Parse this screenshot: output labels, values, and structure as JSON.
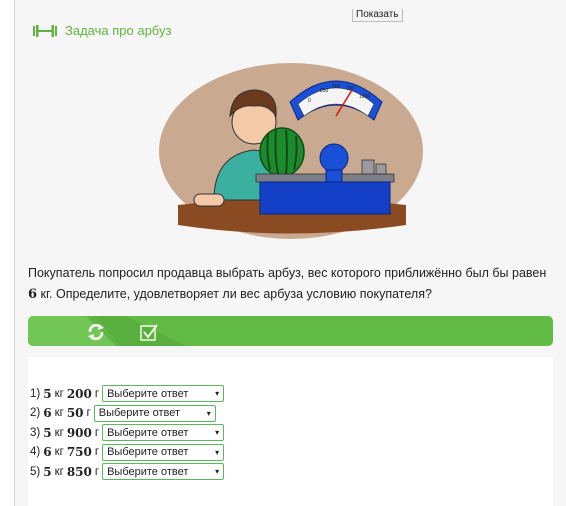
{
  "show_button_label": "Показать",
  "header": {
    "title": "Задача про арбуз",
    "icon": "dumbbell-icon",
    "accent": "#63b33f"
  },
  "illustration": {
    "scale_ticks": [
      "0",
      "250",
      "500",
      "750",
      "1000"
    ],
    "icon": "watermelon-scale-illustration"
  },
  "question": {
    "text_before": "Покупатель попросил продавца выбрать арбуз, вес которого приближённо был бы равен ",
    "value": "6",
    "text_after": " кг. Определите, удовлетворяет ли вес арбуза условию покупателя?"
  },
  "toolbar": {
    "refresh_icon": "refresh-icon",
    "check_icon": "checkmark-icon",
    "color": "#61bb45"
  },
  "answers": [
    {
      "num": "1)",
      "kg": "5",
      "kg_unit": "кг",
      "g": "200",
      "g_unit": "г",
      "select": "Выберите ответ"
    },
    {
      "num": "2)",
      "kg": "6",
      "kg_unit": "кг",
      "g": "50",
      "g_unit": "г",
      "select": "Выберите ответ"
    },
    {
      "num": "3)",
      "kg": "5",
      "kg_unit": "кг",
      "g": "900",
      "g_unit": "г",
      "select": "Выберите ответ"
    },
    {
      "num": "4)",
      "kg": "6",
      "kg_unit": "кг",
      "g": "750",
      "g_unit": "г",
      "select": "Выберите ответ"
    },
    {
      "num": "5)",
      "kg": "5",
      "kg_unit": "кг",
      "g": "850",
      "g_unit": "г",
      "select": "Выберите ответ"
    }
  ]
}
